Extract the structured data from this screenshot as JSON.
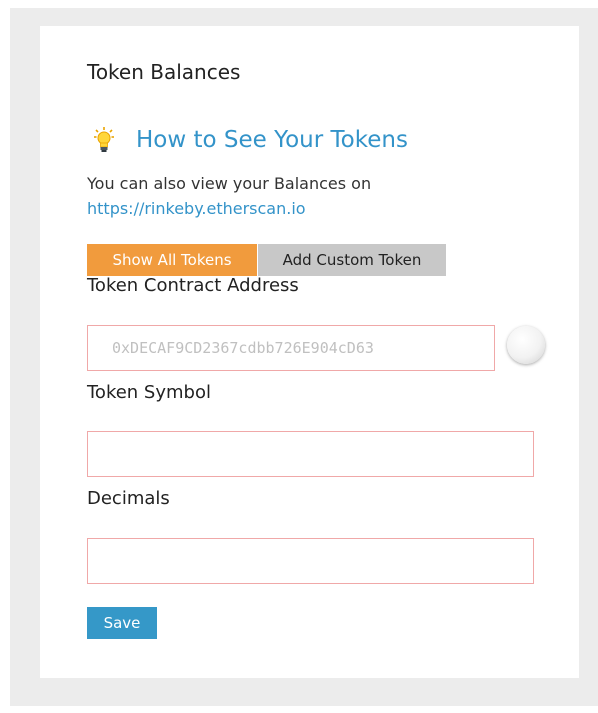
{
  "panel": {
    "title": "Token Balances",
    "howto_label": "How to See Your Tokens",
    "howto_icon": "lightbulb-icon",
    "description": "You can also view your Balances on",
    "link": "https://rinkeby.etherscan.io"
  },
  "tabs": {
    "show_all": "Show All Tokens",
    "add_custom": "Add Custom Token"
  },
  "form": {
    "address_label": "Token Contract Address",
    "address_placeholder": "0xDECAF9CD2367cdbb726E904cD63",
    "symbol_label": "Token Symbol",
    "symbol_value": "",
    "decimals_label": "Decimals",
    "decimals_value": "",
    "save_label": "Save"
  },
  "colors": {
    "accent_orange": "#f19b3d",
    "link_blue": "#3393c9",
    "save_blue": "#3598c8",
    "input_border": "#f0a8a8"
  }
}
